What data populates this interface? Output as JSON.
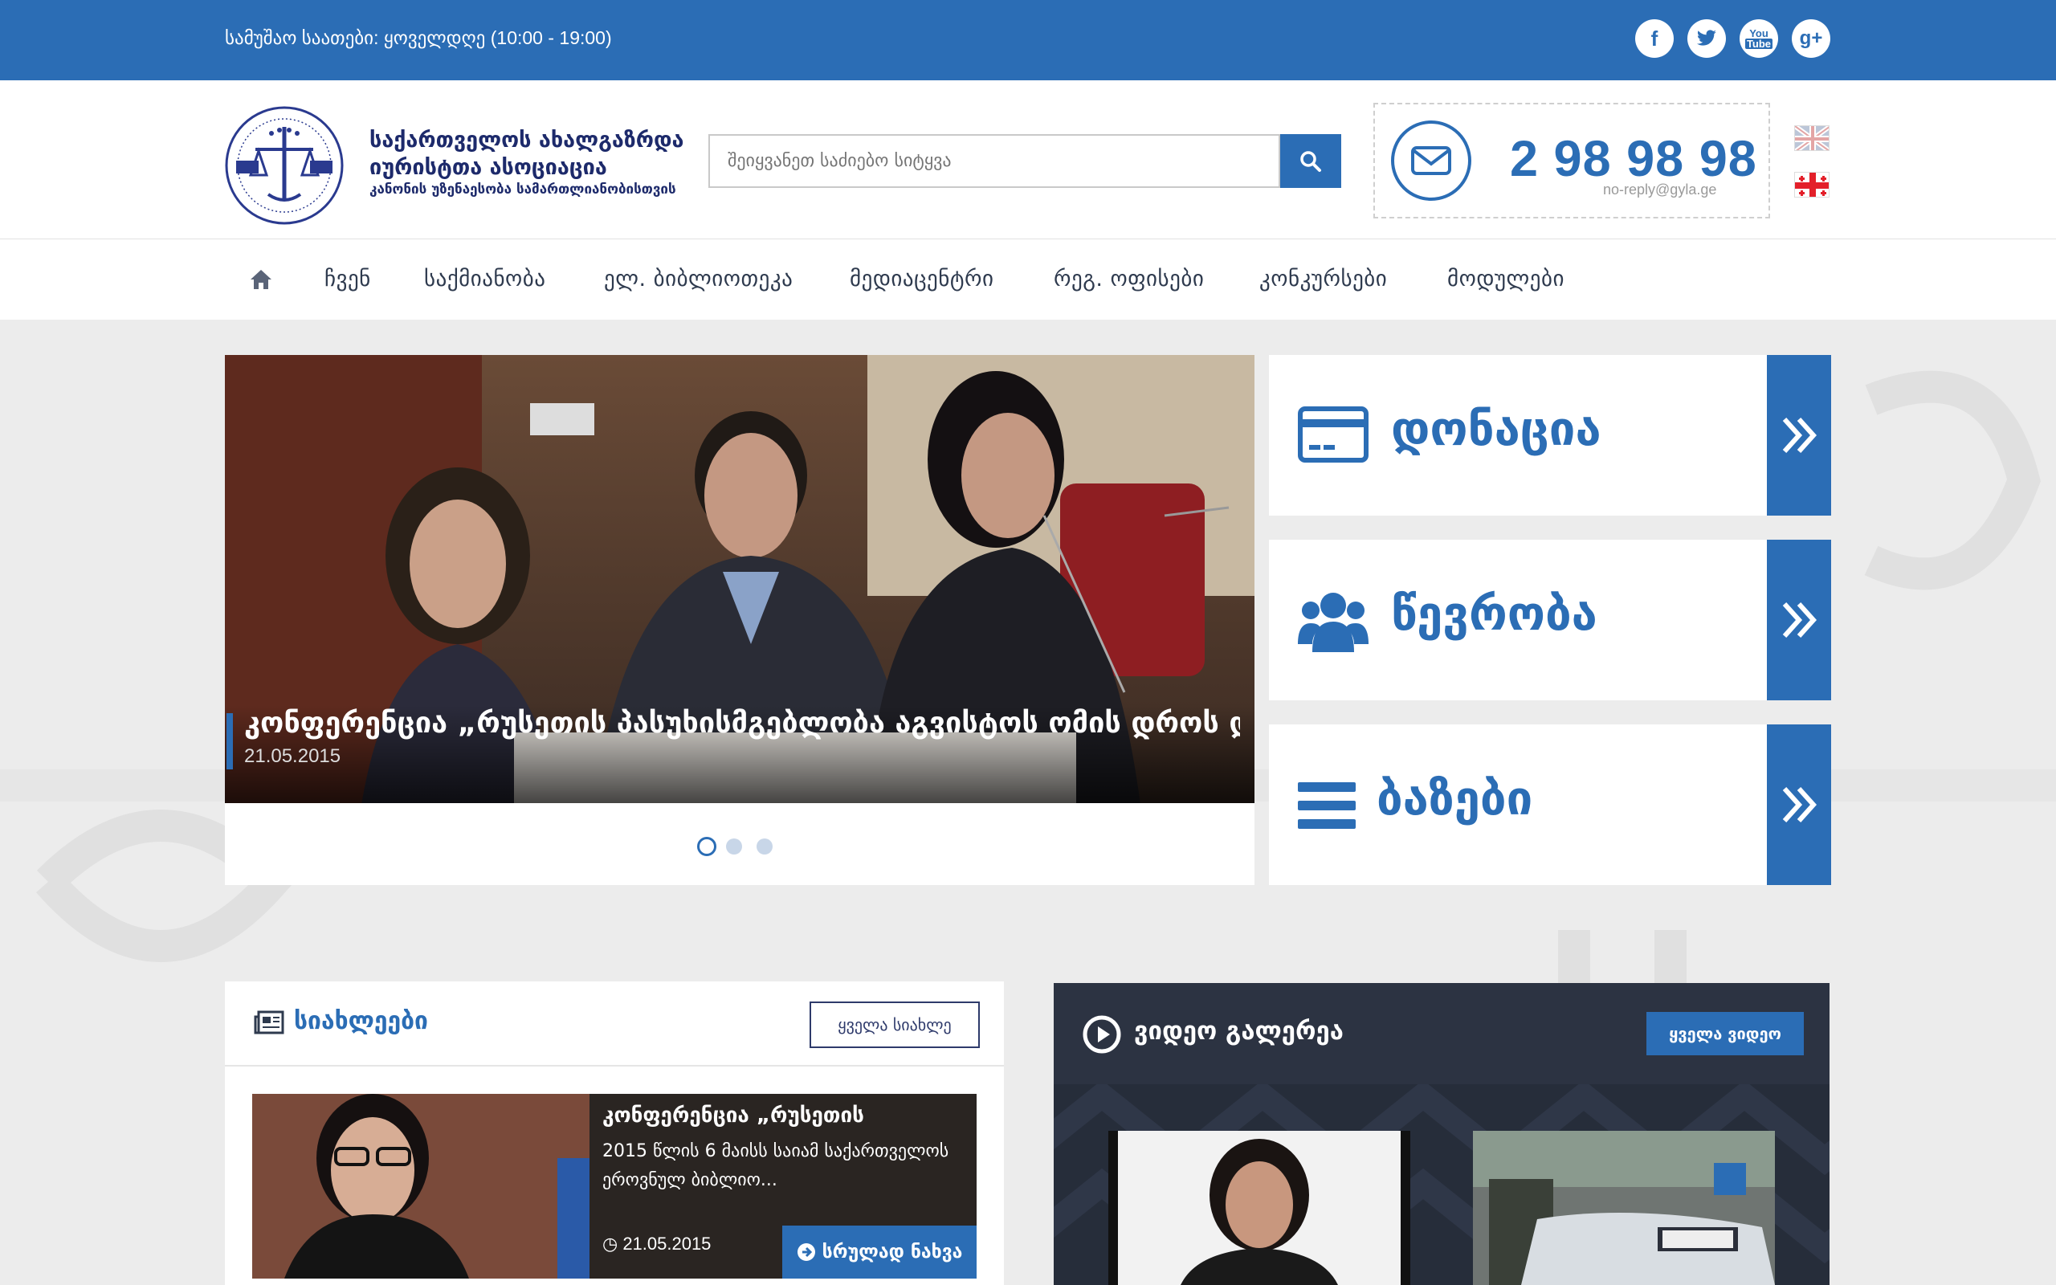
{
  "topbar": {
    "hours": "სამუშაო საათები: ყოველდღე (10:00 - 19:00)",
    "social": [
      {
        "name": "facebook-icon",
        "glyph": "f"
      },
      {
        "name": "twitter-icon",
        "glyph": "t"
      },
      {
        "name": "youtube-icon",
        "glyph": "You Tube"
      },
      {
        "name": "google-plus-icon",
        "glyph": "g+"
      }
    ]
  },
  "header": {
    "org_name_line1": "საქართველოს ახალგაზრდა",
    "org_name_line2": "იურისტთა ასოციაცია",
    "org_tagline": "კანონის უზენაესობა სამართლიანობისთვის",
    "search_placeholder": "შეიყვანეთ საძიებო სიტყვა",
    "phone": "2 98 98 98",
    "email": "no-reply@gyla.ge",
    "languages": [
      "english-flag",
      "georgian-flag"
    ]
  },
  "nav": {
    "items": [
      "ჩვენ",
      "საქმიანობა",
      "ელ. ბიბლიოთეკა",
      "მედიაცენტრი",
      "რეგ. ოფისები",
      "კონკურსები",
      "მოდულები"
    ]
  },
  "slider": {
    "title": "კონფერენცია „რუსეთის პასუხისმგებლობა აგვისტოს ომის დროს და",
    "date": "21.05.2015",
    "slide_count": 3,
    "active_index": 0
  },
  "tiles": [
    {
      "label": "დონაცია",
      "icon": "credit-card-icon"
    },
    {
      "label": "წევრობა",
      "icon": "users-icon"
    },
    {
      "label": "ბაზები",
      "icon": "menu-icon"
    }
  ],
  "news": {
    "title": "სიახლეები",
    "all_label": "ყველა სიახლე",
    "item": {
      "title": "კონფერენცია „რუსეთის",
      "text": "2015 წლის 6 მაისს საიამ საქართველოს ეროვნულ ბიბლიო...",
      "date": "21.05.2015",
      "more_label": "სრულად ნახვა"
    }
  },
  "video": {
    "title": "ვიდეო გალერეა",
    "all_label": "ყველა ვიდეო"
  },
  "colors": {
    "brand_blue": "#2b6db5",
    "dark_navy": "#262d3a"
  }
}
